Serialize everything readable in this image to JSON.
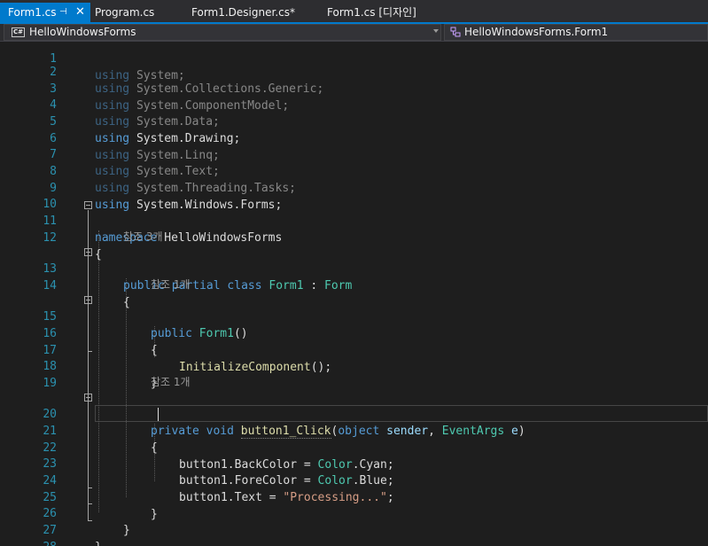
{
  "tabs": [
    {
      "label": "Form1.cs",
      "active": true
    },
    {
      "label": "Program.cs"
    },
    {
      "label": "Form1.Designer.cs*"
    },
    {
      "label": "Form1.cs [디자인]"
    }
  ],
  "tab_pin_glyph": "⊣",
  "tab_close_glyph": "✕",
  "nav": {
    "project_badge": "C#",
    "project": "HelloWindowsForms",
    "class": "HelloWindowsForms.Form1"
  },
  "editor": {
    "line_numbers": [
      "1",
      "2",
      "3",
      "4",
      "5",
      "6",
      "7",
      "8",
      "9",
      "10",
      "11",
      "12",
      "13",
      "14",
      "15",
      "16",
      "17",
      "18",
      "19",
      "20",
      "21",
      "22",
      "23",
      "24",
      "25",
      "26",
      "27",
      "28"
    ],
    "usings": {
      "kw": "using",
      "line1": "System;",
      "line2": "System.Collections.Generic;",
      "line3": "System.ComponentModel;",
      "line4": "System.Data;",
      "line5": "System.Drawing;",
      "line6": "System.Linq;",
      "line7": "System.Text;",
      "line8": "System.Threading.Tasks;",
      "line9": "System.Windows.Forms;"
    },
    "namespace_kw": "namespace",
    "namespace_name": "HelloWindowsForms",
    "refs_3": "참조 3개",
    "refs_1a": "참조 1개",
    "refs_1b": "참조 1개",
    "kw_public": "public",
    "kw_partial": "partial",
    "kw_class": "class",
    "kw_private": "private",
    "kw_void": "void",
    "kw_object": "object",
    "class_name": "Form1",
    "base_class": "Form",
    "ctor_name": "Form1",
    "init_call": "InitializeComponent",
    "handler_name": "button1_Click",
    "param_sender": "sender",
    "param_type2": "EventArgs",
    "param_e": "e",
    "stmt1_lhs": "button1.BackColor = ",
    "stmt1_type": "Color",
    "stmt1_rhs": ".Cyan;",
    "stmt2_lhs": "button1.ForeColor = ",
    "stmt2_type": "Color",
    "stmt2_rhs": ".Blue;",
    "stmt3_lhs": "button1.Text = ",
    "stmt3_str": "\"Processing...\"",
    "stmt3_end": ";",
    "open_brace": "{",
    "close_brace": "}",
    "paren_open": "(",
    "paren_close": ")",
    "call_end": "();",
    "colon": " : ",
    "comma": ", "
  },
  "colors": {
    "keyword": "#569cd6",
    "type": "#4ec9b0",
    "method": "#dcdcaa",
    "string": "#d69d85",
    "line_number": "#2b91af",
    "accent": "#007acc"
  }
}
